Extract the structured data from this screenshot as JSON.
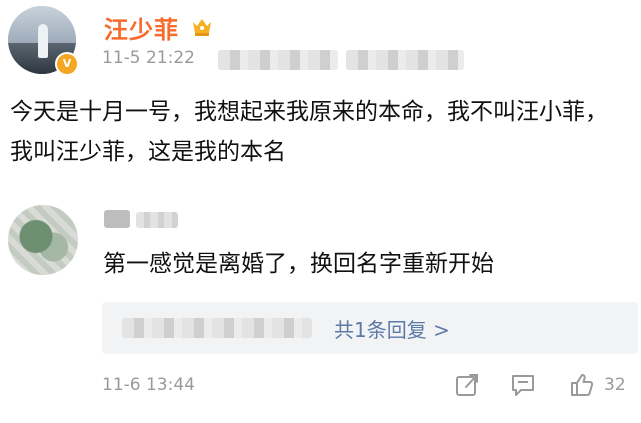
{
  "post": {
    "author": "汪少菲",
    "time": "11-5 21:22",
    "text": "今天是十月一号，我想起来我原来的本命，我不叫汪小菲，我叫汪少菲，这是我的本名"
  },
  "comment": {
    "text": "第一感觉是离婚了，换回名字重新开始",
    "reply_link": "共1条回复 >",
    "time": "11-6 13:44",
    "likes": "32"
  },
  "icons": {
    "badge": "verified-v-icon",
    "crown": "crown-icon",
    "share": "share-icon",
    "comment": "comment-icon",
    "like": "like-icon"
  },
  "colors": {
    "author": "#f86b2c",
    "link": "#5b7aa8",
    "meta": "#9a9a9a"
  }
}
